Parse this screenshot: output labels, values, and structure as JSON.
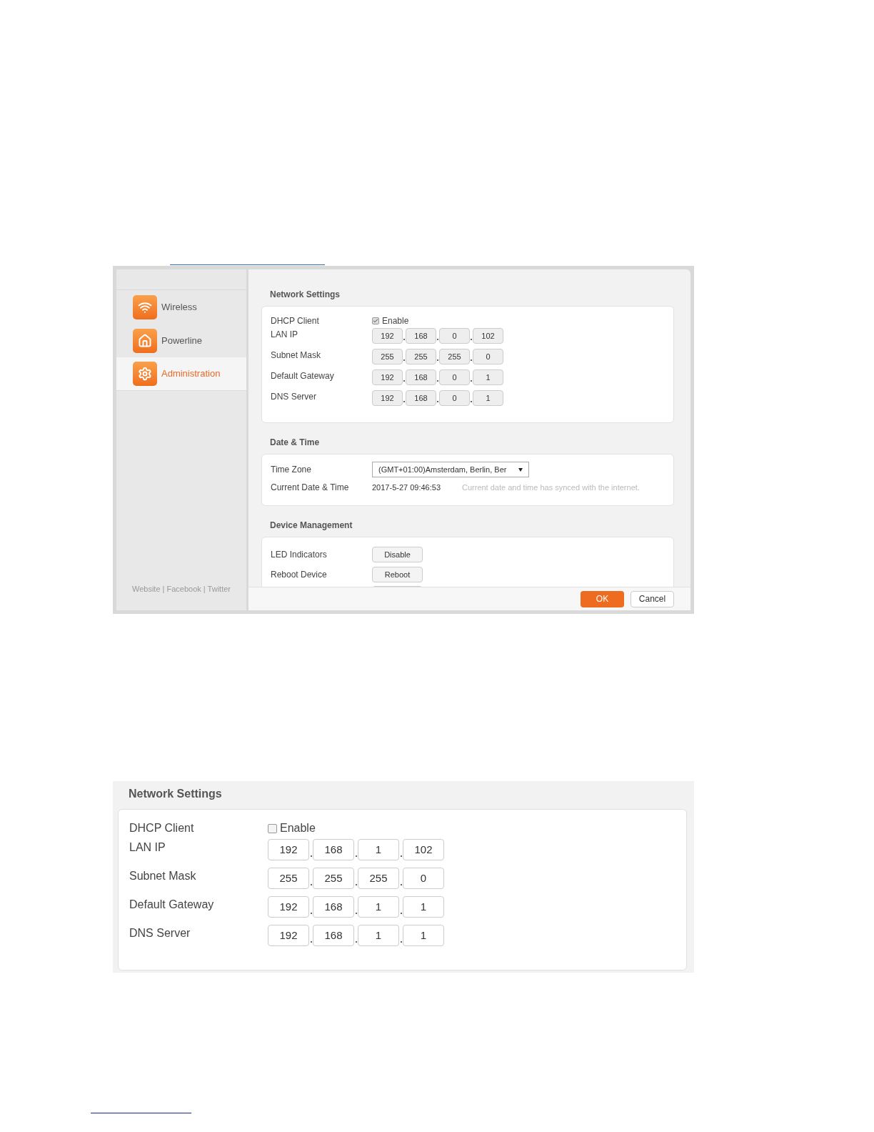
{
  "screenshot_1": {
    "sidebar": {
      "items": [
        {
          "label": "Wireless",
          "selected": false
        },
        {
          "label": "Powerline",
          "selected": false
        },
        {
          "label": "Administration",
          "selected": true
        }
      ],
      "footer_links": "Website | Facebook | Twitter"
    },
    "network_settings": {
      "title": "Network Settings",
      "dhcp_client": {
        "label": "DHCP Client",
        "option": "Enable",
        "checked": true
      },
      "address_rows": [
        {
          "label": "LAN IP",
          "octets": [
            "192",
            "168",
            "0",
            "102"
          ]
        },
        {
          "label": "Subnet Mask",
          "octets": [
            "255",
            "255",
            "255",
            "0"
          ]
        },
        {
          "label": "Default Gateway",
          "octets": [
            "192",
            "168",
            "0",
            "1"
          ]
        },
        {
          "label": "DNS Server",
          "octets": [
            "192",
            "168",
            "0",
            "1"
          ]
        }
      ]
    },
    "date_time": {
      "title": "Date & Time",
      "time_zone": {
        "label": "Time Zone",
        "value": "(GMT+01:00)Amsterdam, Berlin, Ber"
      },
      "current": {
        "label": "Current Date & Time",
        "value": "2017-5-27 09:46:53",
        "note": "Current date and time has synced with the internet."
      }
    },
    "device_management": {
      "title": "Device Management",
      "rows": [
        {
          "label": "LED Indicators",
          "button": "Disable"
        },
        {
          "label": "Reboot Device",
          "button": "Reboot"
        }
      ]
    },
    "buttons": [
      "OK",
      "Cancel"
    ]
  },
  "screenshot_2": {
    "network_settings": {
      "title": "Network Settings",
      "dhcp_client": {
        "label": "DHCP Client",
        "option": "Enable",
        "checked": false
      },
      "address_rows": [
        {
          "label": "LAN IP",
          "octets": [
            "192",
            "168",
            "1",
            "102"
          ]
        },
        {
          "label": "Subnet Mask",
          "octets": [
            "255",
            "255",
            "255",
            "0"
          ]
        },
        {
          "label": "Default Gateway",
          "octets": [
            "192",
            "168",
            "1",
            "1"
          ]
        },
        {
          "label": "DNS Server",
          "octets": [
            "192",
            "168",
            "1",
            "1"
          ]
        }
      ]
    }
  }
}
